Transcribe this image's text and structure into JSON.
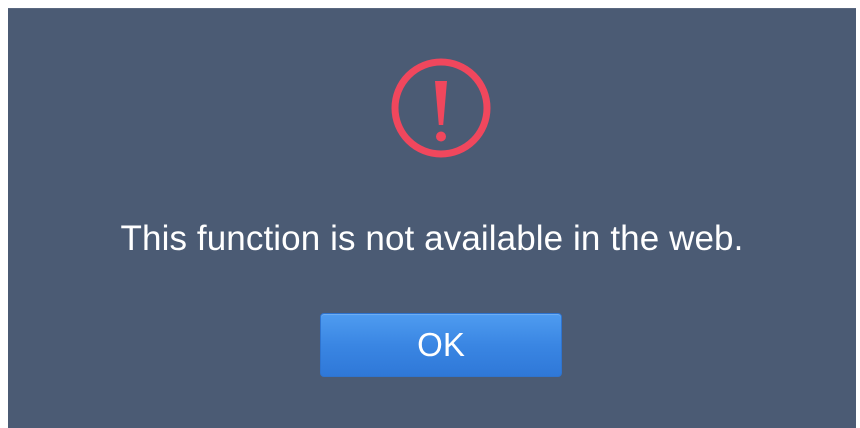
{
  "dialog": {
    "icon": "alert-circle-icon",
    "icon_color": "#f0475d",
    "background_color": "#4b5b74",
    "message": "This function is not available in the web.",
    "ok_label": "OK",
    "button_color": "#3a86e3"
  }
}
